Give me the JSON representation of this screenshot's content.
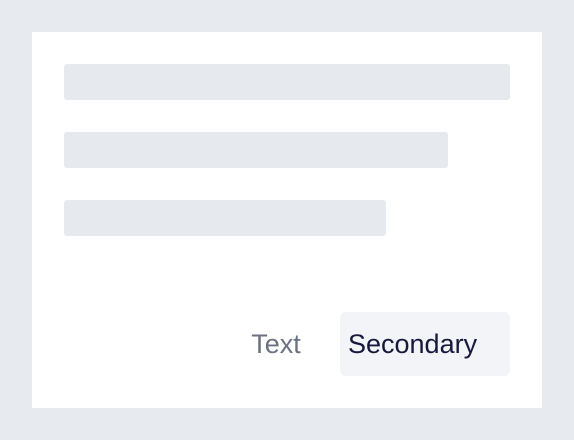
{
  "actions": {
    "text_button_label": "Text",
    "secondary_button_label": "Secondary"
  },
  "colors": {
    "background": "#E7EAEE",
    "card": "#FFFFFF",
    "skeleton": "#E6E9ED",
    "text_button": "#6B7280",
    "secondary_text": "#17183B",
    "secondary_bg": "#F3F4F8"
  }
}
